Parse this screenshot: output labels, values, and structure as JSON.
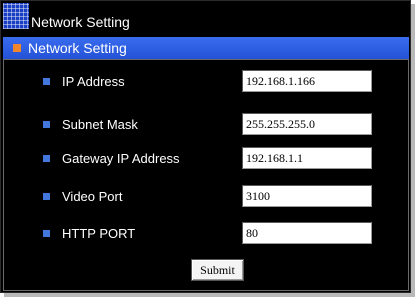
{
  "header": {
    "app_title": "Network Setting",
    "logo_icon": "grid-logo-icon"
  },
  "section": {
    "title": "Network Setting",
    "marker_color": "#f0862c",
    "bar_color": "#2f5fe6"
  },
  "form": {
    "fields": [
      {
        "label": "IP Address",
        "value": "192.168.1.166"
      },
      {
        "label": "Subnet Mask",
        "value": "255.255.255.0"
      },
      {
        "label": "Gateway IP Address",
        "value": "192.168.1.1"
      },
      {
        "label": "Video Port",
        "value": "3100"
      },
      {
        "label": "HTTP PORT",
        "value": "80"
      }
    ],
    "bullet_color": "#4477dd",
    "submit_label": "Submit"
  }
}
